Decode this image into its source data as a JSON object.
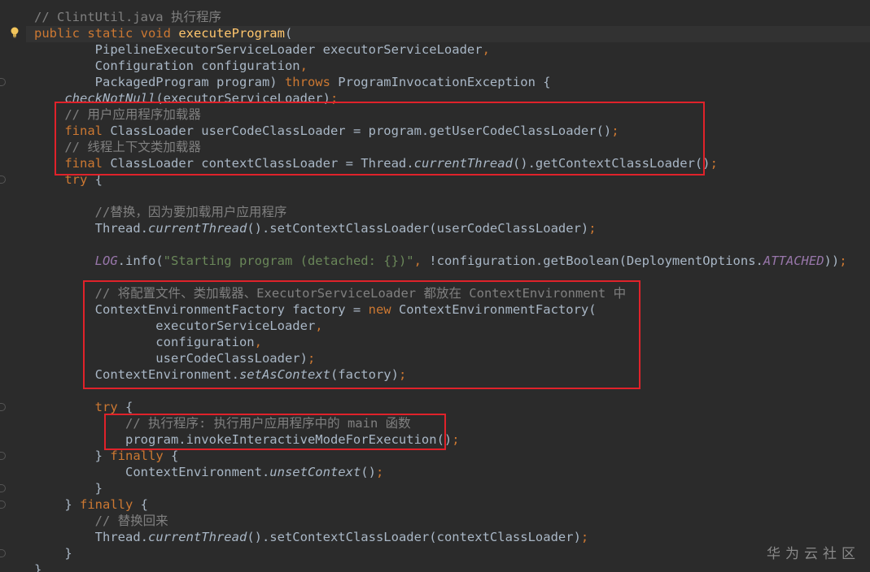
{
  "editor": {
    "theme_bg": "#2b2b2b",
    "lines": [
      [
        {
          "t": "// ClintUtil.java 执行程序",
          "c": "cm"
        }
      ],
      [
        {
          "t": "public static void ",
          "c": "kw"
        },
        {
          "t": "executeProgram",
          "c": "fn"
        },
        {
          "t": "(",
          "c": "pl"
        }
      ],
      [
        {
          "t": "        PipelineExecutorServiceLoader executorServiceLoader",
          "c": "pl"
        },
        {
          "t": ",",
          "c": "kw"
        }
      ],
      [
        {
          "t": "        Configuration configuration",
          "c": "pl"
        },
        {
          "t": ",",
          "c": "kw"
        }
      ],
      [
        {
          "t": "        PackagedProgram program) ",
          "c": "pl"
        },
        {
          "t": "throws ",
          "c": "kw"
        },
        {
          "t": "ProgramInvocationException {",
          "c": "pl"
        }
      ],
      [
        {
          "t": "    ",
          "c": "pl"
        },
        {
          "t": "checkNotNull",
          "c": "ital"
        },
        {
          "t": "(executorServiceLoader)",
          "c": "pl"
        },
        {
          "t": ";",
          "c": "kw"
        }
      ],
      [
        {
          "t": "    // 用户应用程序加载器",
          "c": "cm"
        }
      ],
      [
        {
          "t": "    final ",
          "c": "kw"
        },
        {
          "t": "ClassLoader userCodeClassLoader = program.getUserCodeClassLoader()",
          "c": "pl"
        },
        {
          "t": ";",
          "c": "kw"
        }
      ],
      [
        {
          "t": "    // 线程上下文类加载器",
          "c": "cm"
        }
      ],
      [
        {
          "t": "    final ",
          "c": "kw"
        },
        {
          "t": "ClassLoader contextClassLoader = Thread.",
          "c": "pl"
        },
        {
          "t": "currentThread",
          "c": "ital"
        },
        {
          "t": "().getContextClassLoader()",
          "c": "pl"
        },
        {
          "t": ";",
          "c": "kw"
        }
      ],
      [
        {
          "t": "    try ",
          "c": "kw"
        },
        {
          "t": "{",
          "c": "pl"
        }
      ],
      [
        {
          "t": "",
          "c": "pl"
        }
      ],
      [
        {
          "t": "        //替换，因为要加载用户应用程序",
          "c": "cm"
        }
      ],
      [
        {
          "t": "        Thread.",
          "c": "pl"
        },
        {
          "t": "currentThread",
          "c": "ital"
        },
        {
          "t": "().setContextClassLoader(userCodeClassLoader)",
          "c": "pl"
        },
        {
          "t": ";",
          "c": "kw"
        }
      ],
      [
        {
          "t": "",
          "c": "pl"
        }
      ],
      [
        {
          "t": "        ",
          "c": "pl"
        },
        {
          "t": "LOG",
          "c": "fld"
        },
        {
          "t": ".info(",
          "c": "pl"
        },
        {
          "t": "\"Starting program (detached: {})\"",
          "c": "str"
        },
        {
          "t": ", ",
          "c": "kw"
        },
        {
          "t": "!configuration.getBoolean(DeploymentOptions.",
          "c": "pl"
        },
        {
          "t": "ATTACHED",
          "c": "fld"
        },
        {
          "t": "))",
          "c": "pl"
        },
        {
          "t": ";",
          "c": "kw"
        }
      ],
      [
        {
          "t": "",
          "c": "pl"
        }
      ],
      [
        {
          "t": "        // 将配置文件、类加载器、ExecutorServiceLoader 都放在 ContextEnvironment 中",
          "c": "cm"
        }
      ],
      [
        {
          "t": "        ContextEnvironmentFactory factory = ",
          "c": "pl"
        },
        {
          "t": "new ",
          "c": "kw"
        },
        {
          "t": "ContextEnvironmentFactory(",
          "c": "pl"
        }
      ],
      [
        {
          "t": "                executorServiceLoader",
          "c": "pl"
        },
        {
          "t": ",",
          "c": "kw"
        }
      ],
      [
        {
          "t": "                configuration",
          "c": "pl"
        },
        {
          "t": ",",
          "c": "kw"
        }
      ],
      [
        {
          "t": "                userCodeClassLoader)",
          "c": "pl"
        },
        {
          "t": ";",
          "c": "kw"
        }
      ],
      [
        {
          "t": "        ContextEnvironment.",
          "c": "pl"
        },
        {
          "t": "setAsContext",
          "c": "ital"
        },
        {
          "t": "(factory)",
          "c": "pl"
        },
        {
          "t": ";",
          "c": "kw"
        }
      ],
      [
        {
          "t": "",
          "c": "pl"
        }
      ],
      [
        {
          "t": "        try ",
          "c": "kw"
        },
        {
          "t": "{",
          "c": "pl"
        }
      ],
      [
        {
          "t": "            // 执行程序: 执行用户应用程序中的 main 函数",
          "c": "cm"
        }
      ],
      [
        {
          "t": "            program.invokeInteractiveModeForExecution()",
          "c": "pl"
        },
        {
          "t": ";",
          "c": "kw"
        }
      ],
      [
        {
          "t": "        } ",
          "c": "pl"
        },
        {
          "t": "finally ",
          "c": "kw"
        },
        {
          "t": "{",
          "c": "pl"
        }
      ],
      [
        {
          "t": "            ContextEnvironment.",
          "c": "pl"
        },
        {
          "t": "unsetContext",
          "c": "ital"
        },
        {
          "t": "()",
          "c": "pl"
        },
        {
          "t": ";",
          "c": "kw"
        }
      ],
      [
        {
          "t": "        }",
          "c": "pl"
        }
      ],
      [
        {
          "t": "    } ",
          "c": "pl"
        },
        {
          "t": "finally ",
          "c": "kw"
        },
        {
          "t": "{",
          "c": "pl"
        }
      ],
      [
        {
          "t": "        // 替换回来",
          "c": "cm"
        }
      ],
      [
        {
          "t": "        Thread.",
          "c": "pl"
        },
        {
          "t": "currentThread",
          "c": "ital"
        },
        {
          "t": "().setContextClassLoader(contextClassLoader)",
          "c": "pl"
        },
        {
          "t": ";",
          "c": "kw"
        }
      ],
      [
        {
          "t": "    }",
          "c": "pl"
        }
      ],
      [
        {
          "t": "}",
          "c": "pl"
        }
      ]
    ]
  },
  "highlight_color": "#e0222a",
  "watermark": "华为云社区"
}
